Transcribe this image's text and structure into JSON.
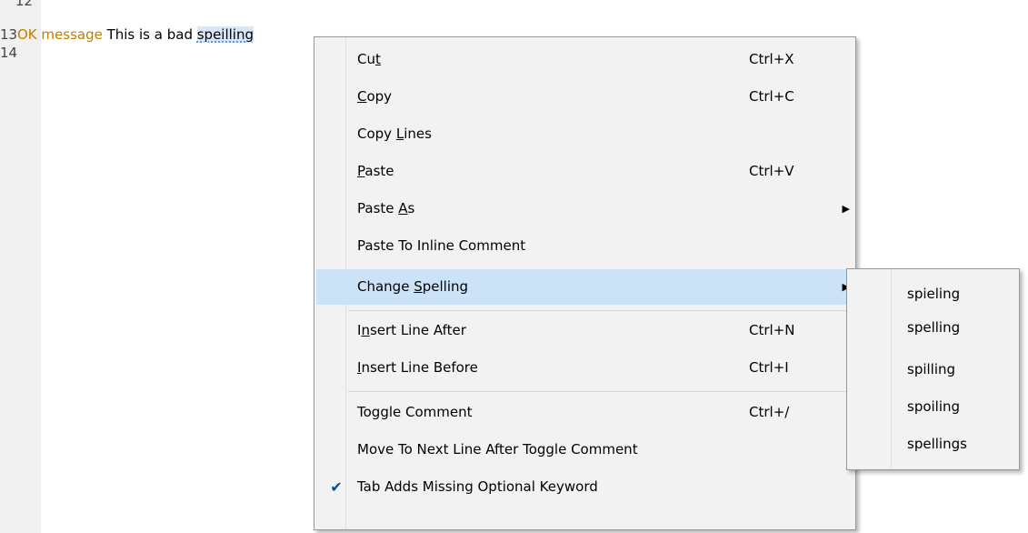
{
  "editor": {
    "lines": [
      {
        "num": "12",
        "keyword": "",
        "text": "",
        "word": ""
      },
      {
        "num": "13",
        "keyword": "OK message",
        "text": " This is a bad ",
        "word": "speilling"
      },
      {
        "num": "14",
        "keyword": "",
        "text": "",
        "word": ""
      }
    ]
  },
  "context_menu": {
    "items": [
      {
        "pre": "Cu",
        "u": "t",
        "post": "",
        "shortcut": "Ctrl+X"
      },
      {
        "pre": "",
        "u": "C",
        "post": "opy",
        "shortcut": "Ctrl+C"
      },
      {
        "pre": "Copy ",
        "u": "L",
        "post": "ines",
        "shortcut": ""
      },
      {
        "pre": "",
        "u": "P",
        "post": "aste",
        "shortcut": "Ctrl+V"
      },
      {
        "pre": "Paste ",
        "u": "A",
        "post": "s",
        "shortcut": "",
        "arrow": "▶"
      },
      {
        "pre": "Paste To Inline Comment",
        "u": "",
        "post": "",
        "shortcut": ""
      },
      {
        "pre": "Change ",
        "u": "S",
        "post": "pelling",
        "shortcut": "",
        "arrow": "▶"
      },
      {
        "pre": "I",
        "u": "n",
        "post": "sert Line After",
        "shortcut": "Ctrl+N"
      },
      {
        "pre": "",
        "u": "I",
        "post": "nsert Line Before",
        "shortcut": "Ctrl+I"
      },
      {
        "pre": "Toggle Comment",
        "u": "",
        "post": "",
        "shortcut": "Ctrl+/"
      },
      {
        "pre": "Move To Next Line After Toggle Comment",
        "u": "",
        "post": "",
        "shortcut": ""
      },
      {
        "pre": "Tab Adds Missing Optional Keyword",
        "u": "",
        "post": "",
        "shortcut": "",
        "checked": true,
        "check": "✔"
      }
    ]
  },
  "spelling_submenu": {
    "suggestions": [
      "spieling",
      "spelling",
      "spilling",
      "spoiling",
      "spellings"
    ]
  }
}
